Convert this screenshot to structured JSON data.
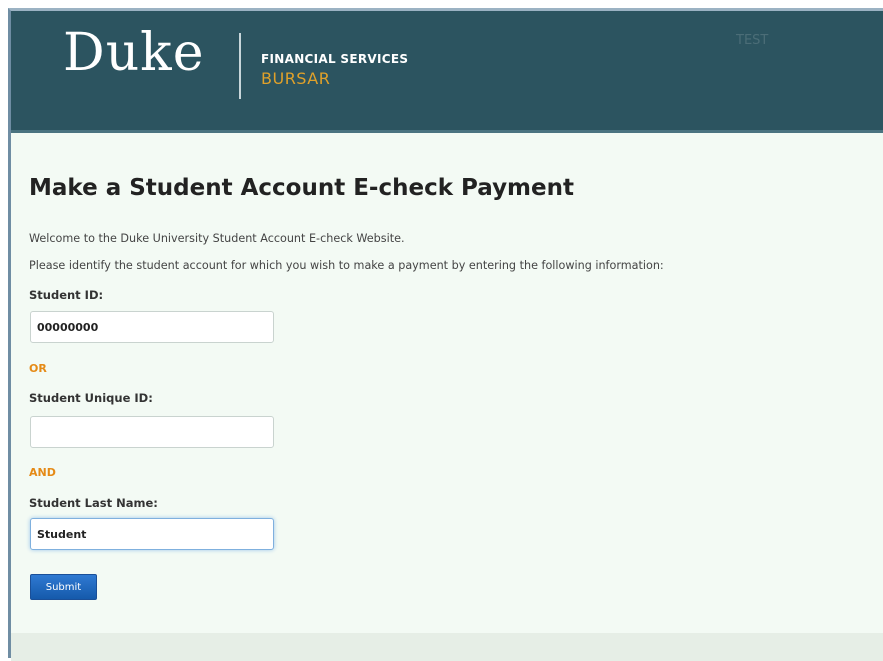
{
  "header": {
    "logo_text": "Duke",
    "division": "FINANCIAL SERVICES",
    "department": "BURSAR",
    "environment_tag": "TEST"
  },
  "main": {
    "title": "Make a Student Account E-check Payment",
    "welcome_text": "Welcome to the Duke University Student Account E-check Website.",
    "instruction_text": "Please identify the student account for which you wish to make a payment by entering the following information:",
    "fields": {
      "student_id": {
        "label": "Student ID:",
        "value": "00000000"
      },
      "or_label": "OR",
      "student_unique_id": {
        "label": "Student Unique ID:",
        "value": ""
      },
      "and_label": "AND",
      "student_last_name": {
        "label": "Student Last Name:",
        "value": "Student"
      }
    },
    "submit_label": "Submit"
  },
  "colors": {
    "header_background": "#2c5460",
    "bursar_accent": "#e0a12a",
    "separator_accent": "#e58a16",
    "content_background": "#f3faf4",
    "button_blue": "#1f68be"
  }
}
